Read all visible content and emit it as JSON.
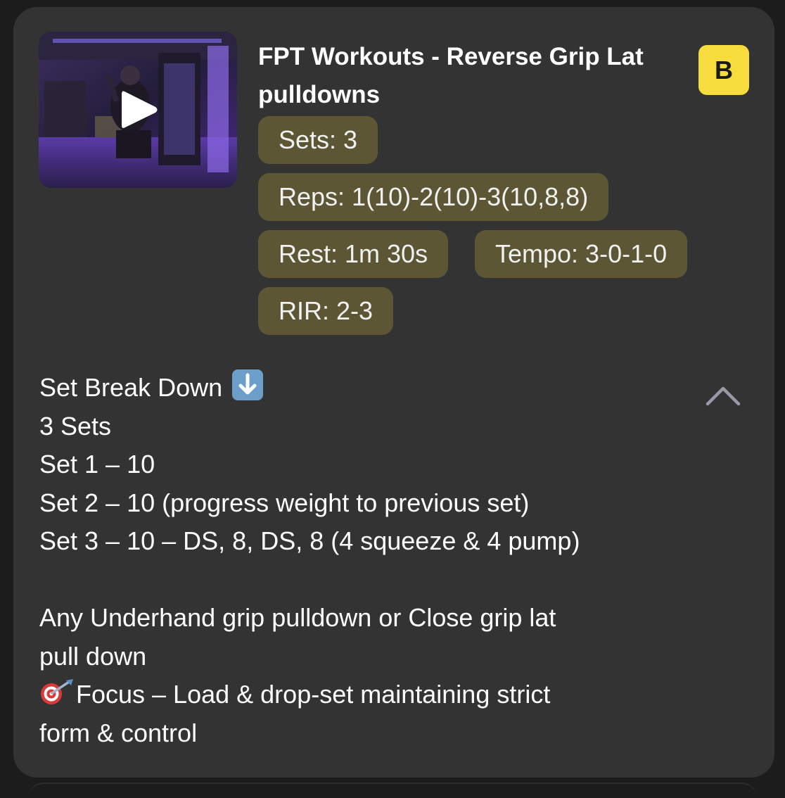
{
  "exercise": {
    "title": "FPT Workouts - Reverse Grip Lat pulldowns",
    "badge": "B",
    "thumbnail_icon": "play-icon",
    "chips": {
      "sets": "Sets: 3",
      "reps": "Reps: 1(10)-2(10)-3(10,8,8)",
      "rest": "Rest: 1m 30s",
      "tempo": "Tempo: 3-0-1-0",
      "rir": "RIR: 2-3"
    }
  },
  "description": {
    "heading": "Set Break Down",
    "heading_icon": "down-arrow-emoji-icon",
    "lines": [
      "3 Sets",
      "Set 1 – 10",
      "Set 2 – 10 (progress weight to previous set)",
      "Set 3 – 10 – DS, 8, DS, 8 (4 squeeze & 4 pump)"
    ],
    "note_line1": "Any Underhand grip pulldown or Close grip lat",
    "note_line2": "pull down",
    "focus_icon": "dart-target-emoji-icon",
    "focus_line1": "Focus – Load & drop-set maintaining strict",
    "focus_line2": "form & control"
  },
  "controls": {
    "collapse_icon": "chevron-up-icon"
  },
  "colors": {
    "card_bg": "#333333",
    "chip_bg": "#5c5634",
    "badge_bg": "#f7dc3e",
    "text": "#ffffff"
  }
}
